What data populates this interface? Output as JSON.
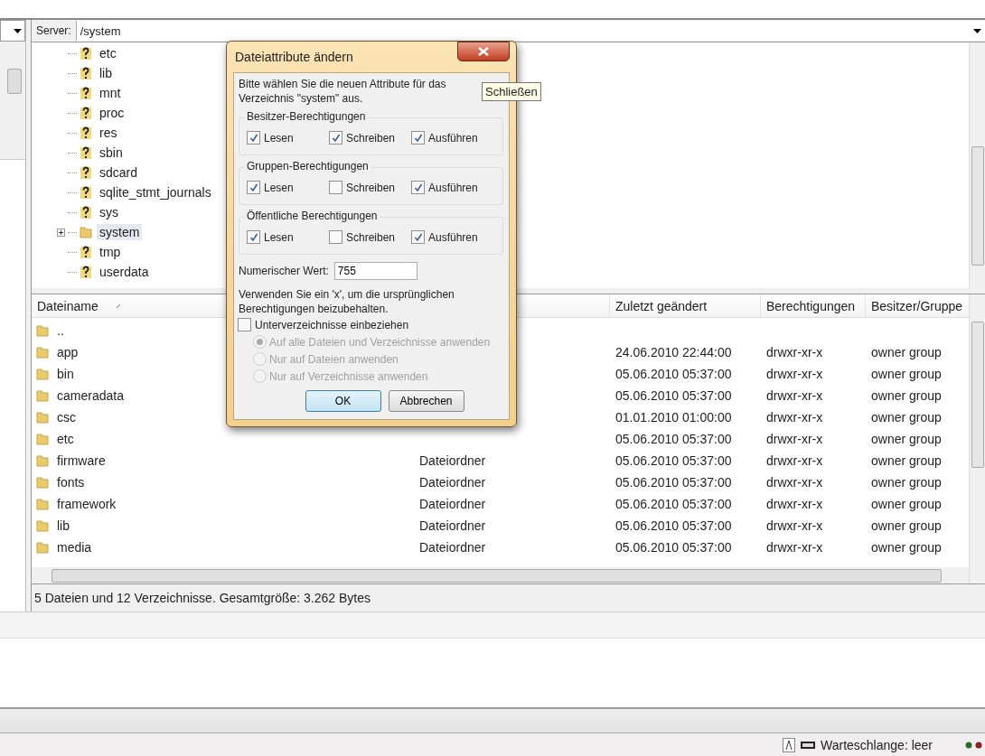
{
  "remote": {
    "server_label": "Server:",
    "path": "/system",
    "tree": [
      {
        "name": "etc",
        "kind": "unknown",
        "selected": false,
        "expandable": false
      },
      {
        "name": "lib",
        "kind": "unknown",
        "selected": false,
        "expandable": false
      },
      {
        "name": "mnt",
        "kind": "unknown",
        "selected": false,
        "expandable": false
      },
      {
        "name": "proc",
        "kind": "unknown",
        "selected": false,
        "expandable": false
      },
      {
        "name": "res",
        "kind": "unknown",
        "selected": false,
        "expandable": false
      },
      {
        "name": "sbin",
        "kind": "unknown",
        "selected": false,
        "expandable": false
      },
      {
        "name": "sdcard",
        "kind": "unknown",
        "selected": false,
        "expandable": false
      },
      {
        "name": "sqlite_stmt_journals",
        "kind": "unknown",
        "selected": false,
        "expandable": false
      },
      {
        "name": "sys",
        "kind": "unknown",
        "selected": false,
        "expandable": false
      },
      {
        "name": "system",
        "kind": "folder",
        "selected": true,
        "expandable": true
      },
      {
        "name": "tmp",
        "kind": "unknown",
        "selected": false,
        "expandable": false
      },
      {
        "name": "userdata",
        "kind": "unknown",
        "selected": false,
        "expandable": false
      }
    ]
  },
  "file_list": {
    "columns": {
      "name": "Dateiname",
      "modified": "Zuletzt geändert",
      "permissions": "Berechtigungen",
      "owner": "Besitzer/Gruppe"
    },
    "rows": [
      {
        "name": ".."
      },
      {
        "name": "app",
        "modified": "24.06.2010 22:44:00",
        "permissions": "drwxr-xr-x",
        "owner": "owner group"
      },
      {
        "name": "bin",
        "modified": "05.06.2010 05:37:00",
        "permissions": "drwxr-xr-x",
        "owner": "owner group"
      },
      {
        "name": "cameradata",
        "modified": "05.06.2010 05:37:00",
        "permissions": "drwxr-xr-x",
        "owner": "owner group"
      },
      {
        "name": "csc",
        "modified": "01.01.2010 01:00:00",
        "permissions": "drwxr-xr-x",
        "owner": "owner group"
      },
      {
        "name": "etc",
        "modified": "05.06.2010 05:37:00",
        "permissions": "drwxr-xr-x",
        "owner": "owner group"
      },
      {
        "name": "firmware",
        "type": "Dateiordner",
        "modified": "05.06.2010 05:37:00",
        "permissions": "drwxr-xr-x",
        "owner": "owner group"
      },
      {
        "name": "fonts",
        "type": "Dateiordner",
        "modified": "05.06.2010 05:37:00",
        "permissions": "drwxr-xr-x",
        "owner": "owner group"
      },
      {
        "name": "framework",
        "type": "Dateiordner",
        "modified": "05.06.2010 05:37:00",
        "permissions": "drwxr-xr-x",
        "owner": "owner group"
      },
      {
        "name": "lib",
        "type": "Dateiordner",
        "modified": "05.06.2010 05:37:00",
        "permissions": "drwxr-xr-x",
        "owner": "owner group"
      },
      {
        "name": "media",
        "type": "Dateiordner",
        "modified": "05.06.2010 05:37:00",
        "permissions": "drwxr-xr-x",
        "owner": "owner group"
      }
    ],
    "status": "5 Dateien und 12 Verzeichnisse. Gesamtgröße: 3.262 Bytes"
  },
  "dialog": {
    "title": "Dateiattribute ändern",
    "close_tooltip": "Schließen",
    "intro": "Bitte wählen Sie die neuen Attribute für das Verzeichnis \"system\" aus.",
    "groups": [
      {
        "title": "Besitzer-Berechtigungen",
        "permissions": [
          {
            "label": "Lesen",
            "checked": true
          },
          {
            "label": "Schreiben",
            "checked": true
          },
          {
            "label": "Ausführen",
            "checked": true
          }
        ]
      },
      {
        "title": "Gruppen-Berechtigungen",
        "permissions": [
          {
            "label": "Lesen",
            "checked": true
          },
          {
            "label": "Schreiben",
            "checked": false
          },
          {
            "label": "Ausführen",
            "checked": true
          }
        ]
      },
      {
        "title": "Öffentliche Berechtigungen",
        "permissions": [
          {
            "label": "Lesen",
            "checked": true
          },
          {
            "label": "Schreiben",
            "checked": false
          },
          {
            "label": "Ausführen",
            "checked": true
          }
        ]
      }
    ],
    "numeric": {
      "label": "Numerischer Wert:",
      "value": "755"
    },
    "hint": "Verwenden Sie ein 'x', um die ursprünglichen Berechtigungen beizubehalten.",
    "recurse": {
      "label": "Unterverzeichnisse einbeziehen",
      "checked": false
    },
    "apply_options": [
      {
        "label": "Auf alle Dateien und Verzeichnisse anwenden",
        "selected": true,
        "disabled": true
      },
      {
        "label": "Nur auf Dateien anwenden",
        "selected": false,
        "disabled": true
      },
      {
        "label": "Nur auf Verzeichnisse anwenden",
        "selected": false,
        "disabled": true
      }
    ],
    "buttons": [
      {
        "label": "OK",
        "default": true
      },
      {
        "label": "Abbrechen",
        "default": false
      }
    ]
  },
  "queue_status": "Warteschlange: leer"
}
